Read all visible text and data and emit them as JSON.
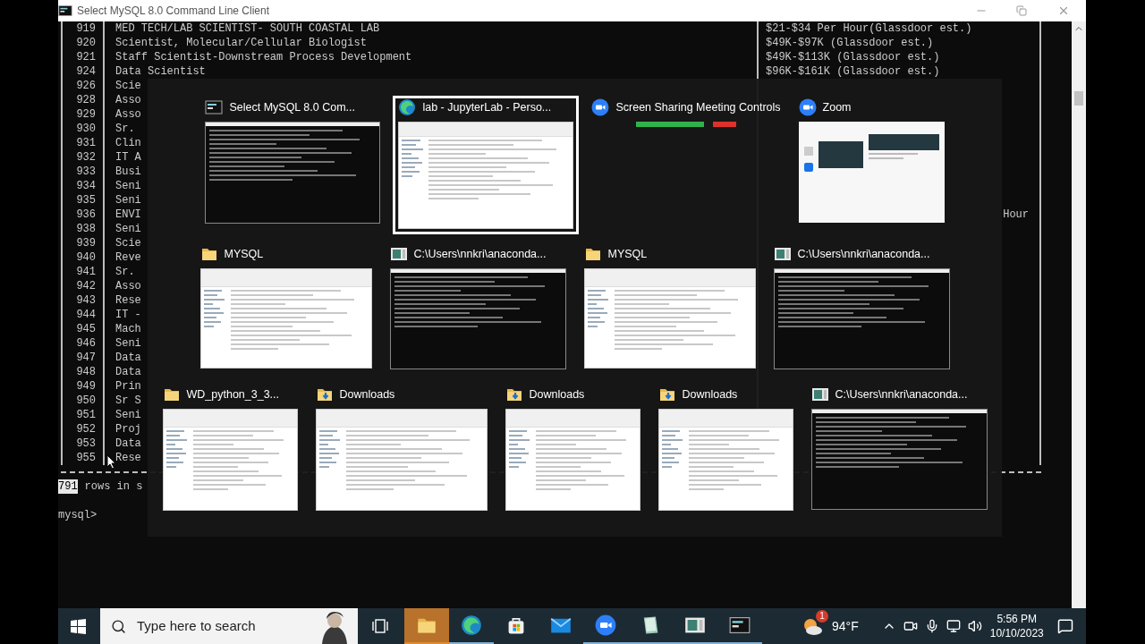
{
  "window": {
    "title": "Select MySQL 8.0 Command Line Client"
  },
  "console": {
    "rows": [
      {
        "id": "919",
        "title": "MED TECH/LAB SCIENTIST- SOUTH COASTAL LAB",
        "salary": "$21-$34 Per Hour(Glassdoor est.)"
      },
      {
        "id": "920",
        "title": "Scientist, Molecular/Cellular Biologist",
        "salary": "$49K-$97K (Glassdoor est.)"
      },
      {
        "id": "921",
        "title": "Staff Scientist-Downstream Process Development",
        "salary": "$49K-$113K (Glassdoor est.)"
      },
      {
        "id": "924",
        "title": "Data Scientist",
        "salary": "$96K-$161K (Glassdoor est.)"
      },
      {
        "id": "926",
        "title": "Scie"
      },
      {
        "id": "928",
        "title": "Asso"
      },
      {
        "id": "929",
        "title": "Asso"
      },
      {
        "id": "930",
        "title": "Sr."
      },
      {
        "id": "931",
        "title": "Clin"
      },
      {
        "id": "932",
        "title": "IT A"
      },
      {
        "id": "933",
        "title": "Busi"
      },
      {
        "id": "934",
        "title": "Seni"
      },
      {
        "id": "935",
        "title": "Seni"
      },
      {
        "id": "936",
        "title": "ENVI",
        "salary_tail": "Hour"
      },
      {
        "id": "938",
        "title": "Seni"
      },
      {
        "id": "939",
        "title": "Scie"
      },
      {
        "id": "940",
        "title": "Reve"
      },
      {
        "id": "941",
        "title": "Sr."
      },
      {
        "id": "942",
        "title": "Asso"
      },
      {
        "id": "943",
        "title": "Rese"
      },
      {
        "id": "944",
        "title": "IT -"
      },
      {
        "id": "945",
        "title": "Mach"
      },
      {
        "id": "946",
        "title": "Seni"
      },
      {
        "id": "947",
        "title": "Data"
      },
      {
        "id": "948",
        "title": "Data"
      },
      {
        "id": "949",
        "title": "Prin"
      },
      {
        "id": "950",
        "title": "Sr S"
      },
      {
        "id": "951",
        "title": "Seni"
      },
      {
        "id": "952",
        "title": "Proj"
      },
      {
        "id": "953",
        "title": "Data"
      },
      {
        "id": "955",
        "title": "Rese"
      }
    ],
    "result": {
      "count": "791",
      "count_selected": true,
      "text": "rows in s"
    },
    "prompt": "mysql>"
  },
  "switcher": {
    "rows": [
      [
        {
          "title": "Select MySQL 8.0 Com...",
          "kind": "mysql",
          "selected": false
        },
        {
          "title": "lab - JupyterLab - Perso...",
          "kind": "browser",
          "selected": true
        },
        {
          "title": "Screen Sharing Meeting Controls",
          "kind": "meeting",
          "selected": false
        },
        {
          "title": "Zoom",
          "kind": "zoom",
          "selected": false
        }
      ],
      [
        {
          "title": "MYSQL",
          "kind": "folder",
          "selected": false
        },
        {
          "title": "C:\\Users\\nnkri\\anaconda...",
          "kind": "console",
          "selected": false
        },
        {
          "title": "MYSQL",
          "kind": "folder",
          "selected": false
        },
        {
          "title": "C:\\Users\\nnkri\\anaconda...",
          "kind": "console",
          "selected": false
        }
      ],
      [
        {
          "title": "WD_python_3_3...",
          "kind": "folder-small",
          "selected": false
        },
        {
          "title": "Downloads",
          "kind": "downloads",
          "selected": false
        },
        {
          "title": "Downloads",
          "kind": "downloads-small",
          "selected": false
        },
        {
          "title": "Downloads",
          "kind": "downloads-small",
          "selected": false
        },
        {
          "title": "C:\\Users\\nnkri\\anaconda...",
          "kind": "console",
          "selected": false
        }
      ]
    ]
  },
  "taskbar": {
    "search": {
      "placeholder": "Type here to search"
    },
    "apps": [
      {
        "kind": "explorer",
        "running": true,
        "selected": true
      },
      {
        "kind": "edge",
        "running": true,
        "selected": false
      },
      {
        "kind": "store",
        "running": false,
        "selected": false
      },
      {
        "kind": "mail",
        "running": false,
        "selected": false
      },
      {
        "kind": "zoom",
        "running": true,
        "selected": false
      },
      {
        "kind": "pad",
        "running": true,
        "selected": false
      },
      {
        "kind": "console",
        "running": true,
        "selected": false
      },
      {
        "kind": "mysql",
        "running": true,
        "selected": false
      }
    ],
    "weather": {
      "temperature": "94°F",
      "badge": "1"
    },
    "clock": {
      "time": "5:56 PM",
      "date": "10/10/2023"
    }
  }
}
